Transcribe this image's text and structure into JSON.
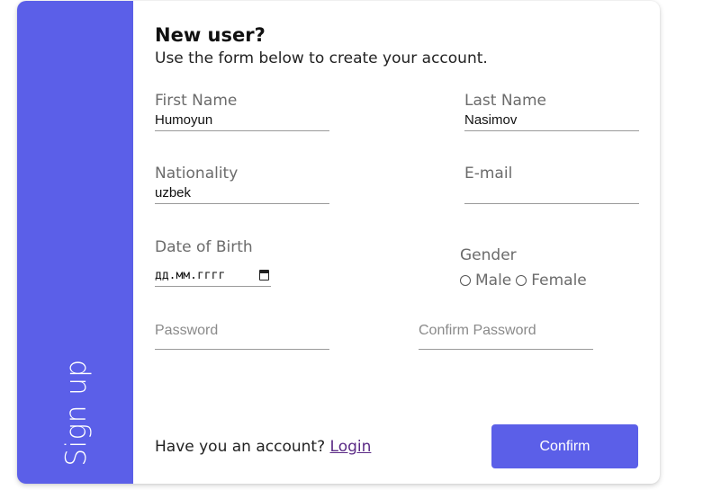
{
  "sidebar": {
    "title": "Sign up"
  },
  "header": {
    "title": "New user?",
    "subtitle": "Use the form below to create your account."
  },
  "form": {
    "first_name": {
      "label": "First Name",
      "value": "Humoyun"
    },
    "last_name": {
      "label": "Last Name",
      "value": "Nasimov"
    },
    "nationality": {
      "label": "Nationality",
      "value": "uzbek"
    },
    "email": {
      "label": "E-mail",
      "value": ""
    },
    "dob": {
      "label": "Date of Birth",
      "placeholder": "дд.мм.гггг"
    },
    "gender": {
      "label": "Gender",
      "options": [
        "Male",
        "Female"
      ]
    },
    "password": {
      "placeholder": "Password"
    },
    "confirm_password": {
      "placeholder": "Confirm Password"
    }
  },
  "footer": {
    "account_text": "Have you an account?",
    "login_label": "Login",
    "confirm_label": "Confirm"
  },
  "colors": {
    "accent": "#5b5fe8",
    "link": "#5b2a86"
  },
  "icons": {
    "date_picker": "calendar-icon",
    "gender_radio": "radio-icon"
  }
}
